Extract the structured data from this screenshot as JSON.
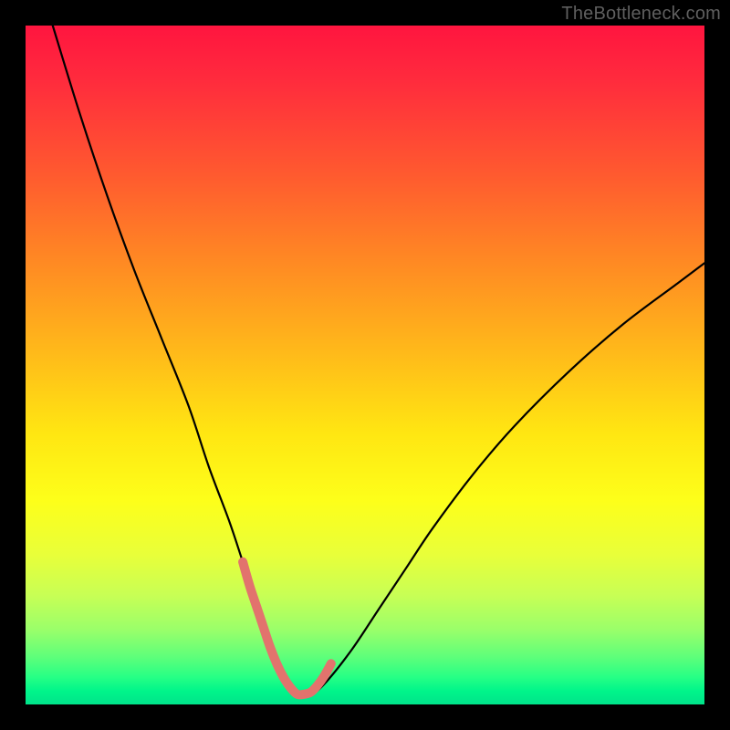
{
  "watermark": "TheBottleneck.com",
  "chart_data": {
    "type": "line",
    "title": "",
    "xlabel": "",
    "ylabel": "",
    "xlim": [
      0,
      100
    ],
    "ylim": [
      0,
      100
    ],
    "grid": false,
    "series": [
      {
        "name": "bottleneck-curve",
        "color": "#000000",
        "x": [
          4,
          8,
          12,
          16,
          20,
          24,
          27,
          30,
          32,
          34,
          35.5,
          37,
          38.5,
          40,
          42,
          44,
          48,
          52,
          56,
          60,
          66,
          72,
          80,
          88,
          96,
          100
        ],
        "y": [
          100,
          87,
          75,
          64,
          54,
          44,
          35,
          27,
          21,
          15,
          10,
          6,
          3,
          1.5,
          1.5,
          3,
          8,
          14,
          20,
          26,
          34,
          41,
          49,
          56,
          62,
          65
        ]
      },
      {
        "name": "highlight-valley",
        "color": "#e2736d",
        "x": [
          32,
          33,
          34,
          35,
          36,
          37,
          38,
          39,
          40,
          41,
          42,
          43,
          44,
          45
        ],
        "y": [
          21,
          17.5,
          14.5,
          11.5,
          8.5,
          6,
          4,
          2.5,
          1.5,
          1.5,
          1.8,
          2.8,
          4.2,
          6
        ]
      }
    ],
    "gradient_stops": [
      {
        "pos": 0,
        "color": "#ff153f"
      },
      {
        "pos": 22,
        "color": "#ff5a2f"
      },
      {
        "pos": 48,
        "color": "#ffb91a"
      },
      {
        "pos": 70,
        "color": "#fdff1a"
      },
      {
        "pos": 89,
        "color": "#9aff6a"
      },
      {
        "pos": 100,
        "color": "#00e38a"
      }
    ]
  }
}
